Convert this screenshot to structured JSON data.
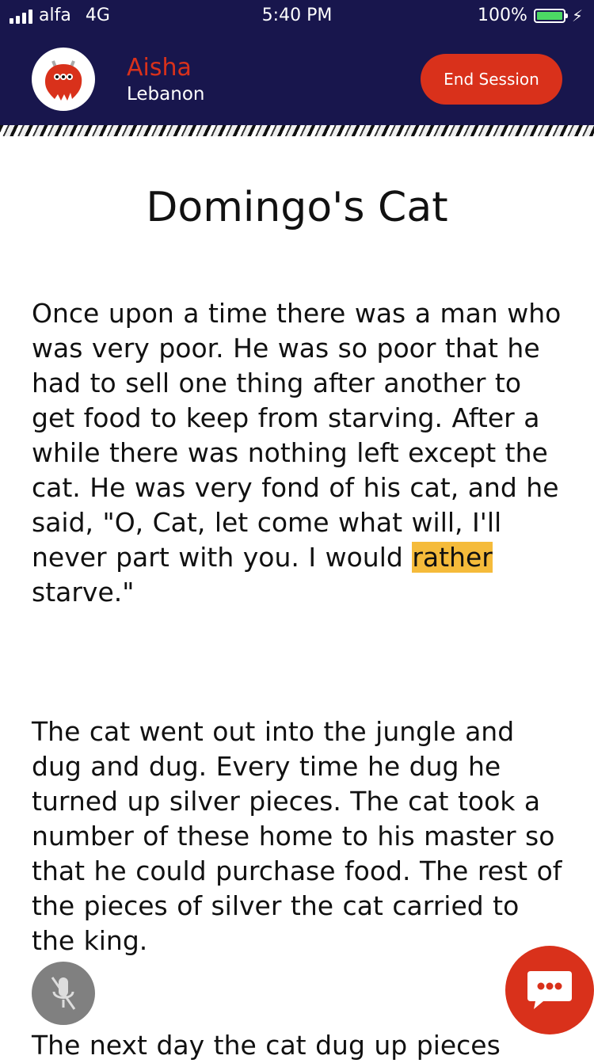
{
  "status_bar": {
    "carrier": "alfa",
    "network": "4G",
    "time": "5:40 PM",
    "battery": "100%",
    "signal_icon": "signal-bars-icon",
    "battery_icon": "battery-full-icon",
    "charging_icon": "charging-bolt-icon"
  },
  "header": {
    "user_name": "Aisha",
    "user_country": "Lebanon",
    "end_session_label": "End Session",
    "avatar_icon": "red-monster-avatar-icon",
    "name_color": "#d9311b",
    "background_color": "#18164d"
  },
  "story": {
    "title": "Domingo's Cat",
    "paragraph1_before": "Once upon a time there was a man who was very poor. He was so poor that he had to sell one thing after another to get food to keep from starving. After a while there was nothing left except the cat. He was very fond of his cat, and he said, \"O, Cat, let come what will, I'll never part with you. I would ",
    "paragraph1_highlight": "rather",
    "paragraph1_after": " starve.\"",
    "highlight_color": "#f5bb3a",
    "paragraph2": "The cat went out into the jungle and dug and dug. Every time he dug he turned up silver pieces. The cat took a number of these home to  his master so that he could purchase food. The rest of the pieces of silver the cat carried to the king.",
    "paragraph3": "The next day the cat dug up pieces"
  },
  "controls": {
    "mic_icon": "microphone-muted-icon",
    "chat_icon": "chat-bubble-icon",
    "accent_color": "#d9311b"
  }
}
